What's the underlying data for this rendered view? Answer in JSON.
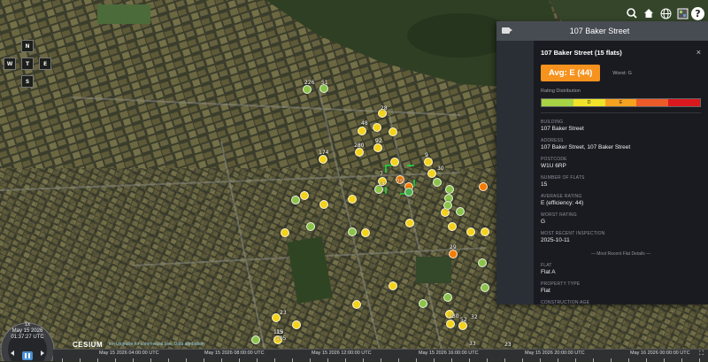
{
  "toolbar": {
    "search_icon": "search-icon",
    "home_icon": "home-icon",
    "globe_icon": "globe-icon",
    "layers_icon": "layers-icon",
    "help_label": "?"
  },
  "compass": {
    "n": "N",
    "s": "S",
    "e": "E",
    "w": "W",
    "t": "T"
  },
  "map_labels": [
    "226",
    "51",
    "28",
    "48",
    "280",
    "92",
    "174",
    "7",
    "9",
    "30",
    "13",
    "75",
    "23",
    "29",
    "130",
    "32",
    "105",
    "119",
    "23",
    "52",
    "33",
    "15"
  ],
  "infobox": {
    "window_title": "107 Baker Street",
    "heading": "107 Baker Street (15 flats)",
    "close": "×",
    "avg": "Avg: E (44)",
    "worst_short": "Worst: G",
    "rating_distribution": "Rating Distribution",
    "bar_labels": [
      "",
      "D",
      "E",
      "",
      ""
    ],
    "bar_colors": [
      "#a7d444",
      "#f2e32a",
      "#f6a11f",
      "#ec5b29",
      "#d9191e"
    ],
    "fields": [
      {
        "label": "BUILDING",
        "value": "107 Baker Street"
      },
      {
        "label": "ADDRESS",
        "value": "107 Baker Street, 107 Baker Street"
      },
      {
        "label": "POSTCODE",
        "value": "W1U 6RP"
      },
      {
        "label": "NUMBER OF FLATS",
        "value": "15"
      },
      {
        "label": "AVERAGE RATING",
        "value": "E (efficiency: 44)"
      },
      {
        "label": "WORST RATING",
        "value": "G"
      },
      {
        "label": "MOST RECENT INSPECTION",
        "value": "2025-10-11"
      }
    ],
    "recent_section": "— Most Recent Flat Details —",
    "fields2": [
      {
        "label": "FLAT",
        "value": "Flat A"
      },
      {
        "label": "PROPERTY TYPE",
        "value": "Flat"
      },
      {
        "label": "CONSTRUCTION AGE",
        "value": ""
      }
    ]
  },
  "clock": {
    "speed": "1x",
    "date": "May 15 2026",
    "time": "01:37:27 UTC"
  },
  "timeline": [
    "May 15 2026 04:00:00 UTC",
    "May 15 2026 08:00:00 UTC",
    "May 15 2026 12:00:00 UTC",
    "May 15 2026 16:00:00 UTC",
    "May 15 2026 20:00:00 UTC",
    "May 16 2026 00:00:00 UTC"
  ],
  "credits": {
    "brand": "CESIUM",
    "sub": "ion  Upgrade for commercial use.  Data attribution"
  }
}
